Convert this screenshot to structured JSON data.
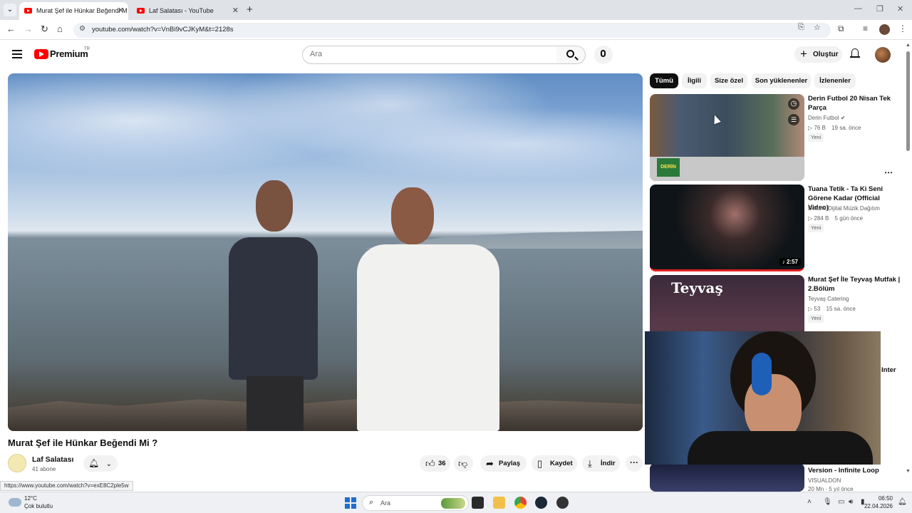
{
  "browser": {
    "tabs": [
      {
        "label": "Murat Şef ile Hünkar Beğendi M",
        "active": true
      },
      {
        "label": "Laf Salatası - YouTube",
        "active": false
      }
    ],
    "new_tab_label": "+",
    "url": "youtube.com/watch?v=VnBi9vCJKyM&t=2128s",
    "status_url": "https://www.youtube.com/watch?v=exE8C2ple5w"
  },
  "header": {
    "brand": "Premium",
    "region": "TR",
    "search_placeholder": "Ara",
    "create_label": "Oluştur"
  },
  "video": {
    "title": "Murat Şef ile Hünkar Beğendi Mi ?",
    "channel": "Laf Salatası",
    "subscribers": "41 abone",
    "likes": "36",
    "share_label": "Paylaş",
    "save_label": "Kaydet",
    "download_label": "İndir"
  },
  "chips": [
    "Tümü",
    "İlgili",
    "Size özel",
    "Son yüklenenler",
    "İzlenenler"
  ],
  "recommendations": [
    {
      "title": "Derin Futbol 20 Nisan Tek Parça",
      "channel": "Derin Futbol",
      "verified": true,
      "views": "76 B",
      "age": "19 sa. önce",
      "badge": "Yeni",
      "thumb_logo": "DERİN FUTBOL"
    },
    {
      "title": "Tuana Tetik - Ta Ki Seni Görene Kadar (Official Video)",
      "channel": "Dotune Dijital Müzik Dağıtım",
      "views": "284 B",
      "age": "5 gün önce",
      "badge": "Yeni",
      "duration": "2:57"
    },
    {
      "title": "Murat Şef İle Teyvaş Mutfak | 2.Bölüm",
      "channel": "Teyvaş Catering",
      "views": "53",
      "age": "15 sa. önce",
      "badge": "Yeni",
      "thumb_brand": "Teyvaş"
    },
    {
      "title": "Version - Infinite Loop",
      "channel": "VISUALDON",
      "partial_meta": "20 Mn · 5 yıl önce"
    }
  ],
  "partial_text": "Inter",
  "taskbar": {
    "temp": "12°C",
    "weather": "Çok bulutlu",
    "search_placeholder": "Ara",
    "time": "06:50",
    "date": "22.04.2026"
  },
  "colors": {
    "accent": "#ff0000",
    "chip_active": "#0f0f0f"
  }
}
